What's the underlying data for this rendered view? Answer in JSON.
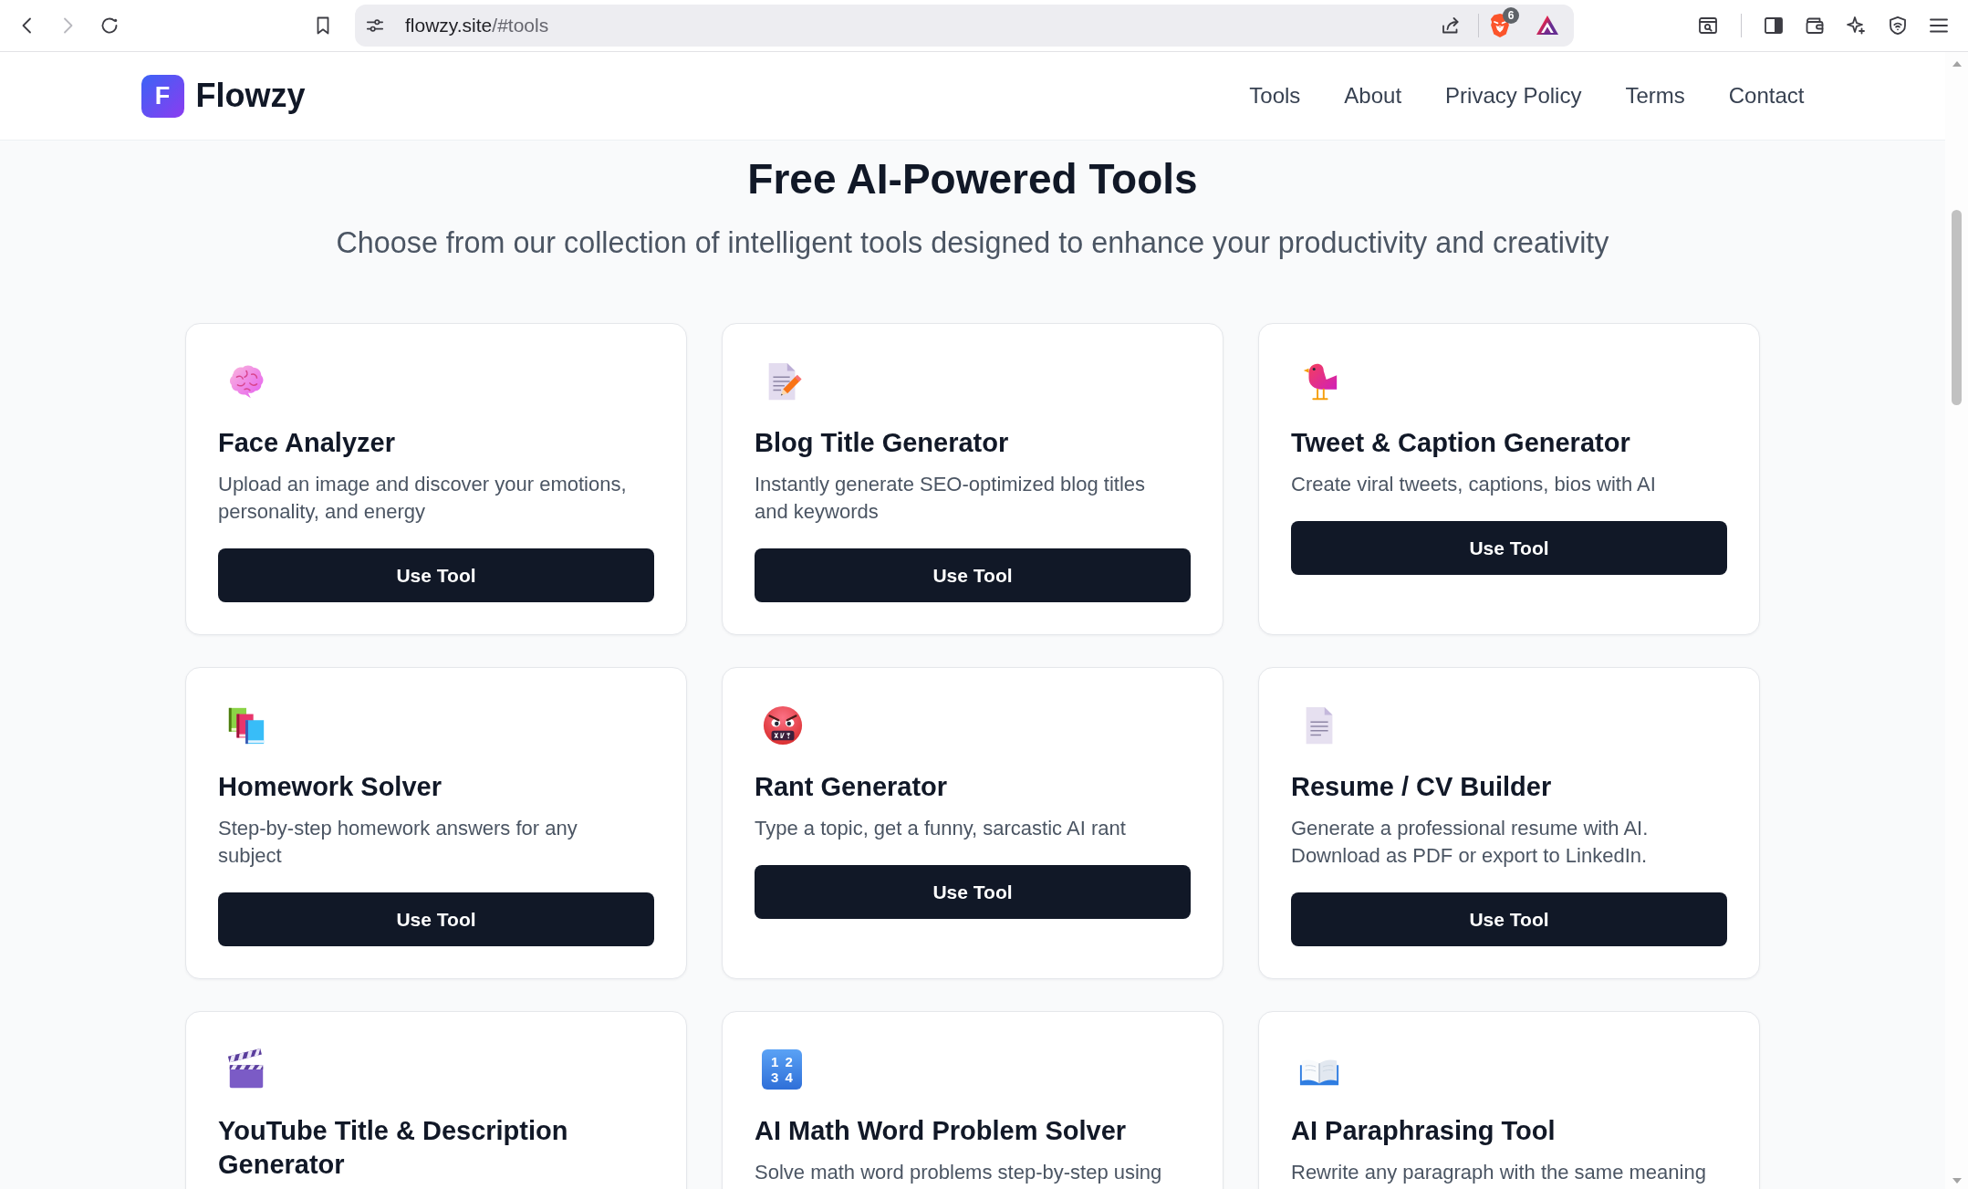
{
  "browser": {
    "back": {
      "disabled": false
    },
    "forward": {
      "disabled": true
    },
    "url": {
      "host": "flowzy.site",
      "path": "/#tools"
    },
    "shields_count": "6"
  },
  "header": {
    "logo_letter": "F",
    "brand": "Flowzy",
    "nav": [
      "Tools",
      "About",
      "Privacy Policy",
      "Terms",
      "Contact"
    ]
  },
  "hero": {
    "title": "Free AI-Powered Tools",
    "subtitle": "Choose from our collection of intelligent tools designed to enhance your productivity and creativity"
  },
  "tool_rows": [
    [
      {
        "title": "Face Analyzer",
        "description": "Upload an image and discover your emotions, personality, and energy",
        "button": "Use Tool"
      },
      {
        "title": "Blog Title Generator",
        "description": "Instantly generate SEO-optimized blog titles and keywords",
        "button": "Use Tool"
      },
      {
        "title": "Tweet & Caption Generator",
        "description": "Create viral tweets, captions, bios with AI",
        "button": "Use Tool"
      }
    ],
    [
      {
        "title": "Homework Solver",
        "description": "Step-by-step homework answers for any subject",
        "button": "Use Tool"
      },
      {
        "title": "Rant Generator",
        "description": "Type a topic, get a funny, sarcastic AI rant",
        "button": "Use Tool"
      },
      {
        "title": "Resume / CV Builder",
        "description": "Generate a professional resume with AI. Download as PDF or export to LinkedIn.",
        "button": "Use Tool"
      }
    ],
    [
      {
        "title": "YouTube Title & Description Generator"
      },
      {
        "title": "AI Math Word Problem Solver",
        "icon_text": "1 2\n3 4",
        "description": "Solve math word problems step-by-step using"
      },
      {
        "title": "AI Paraphrasing Tool",
        "description": "Rewrite any paragraph with the same meaning"
      }
    ]
  ]
}
